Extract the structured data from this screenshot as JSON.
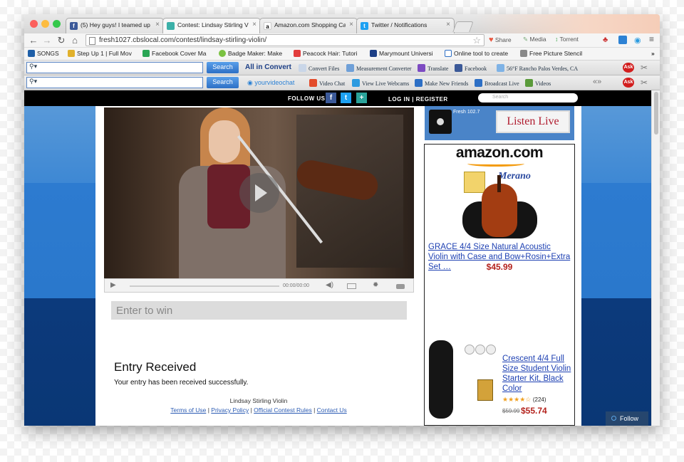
{
  "tabs": [
    {
      "label": "(5) Hey guys! I teamed up",
      "icon": "facebook-icon",
      "color": "#3b5998",
      "glyph": "f"
    },
    {
      "label": "Contest: Lindsay Stirling V",
      "icon": "contest-page-icon",
      "color": "#3bb0a8",
      "glyph": ""
    },
    {
      "label": "Amazon.com Shopping Ca",
      "icon": "amazon-icon",
      "color": "#111111",
      "glyph": "a"
    },
    {
      "label": "Twitter / Notifications",
      "icon": "twitter-icon",
      "color": "#1da1f2",
      "glyph": "t"
    }
  ],
  "nav": {
    "url": "fresh1027.cbslocal.com/contest/lindsay-stirling-violin/",
    "share": "Share",
    "media": "Media",
    "torrent": "Torrent"
  },
  "bookmarks": [
    "SONGS",
    "Step Up 1 | Full Mov",
    "Facebook Cover Ma",
    "Badge Maker: Make",
    "Peacock Hair: Tutori",
    "Marymount Universi",
    "Online tool to create",
    "Free Picture Stencil"
  ],
  "toolbar1": {
    "search_btn": "Search",
    "items": [
      "All in Convert",
      "Convert Files",
      "Measurement Converter",
      "Translate",
      "Facebook",
      "56°F Rancho Palos Verdes, CA"
    ]
  },
  "toolbar2": {
    "search_btn": "Search",
    "items": [
      "yourvideochat",
      "Video Chat",
      "View Live Webcams",
      "Make New Friends",
      "Broadcast Live",
      "Videos"
    ]
  },
  "site": {
    "follow_us": "FOLLOW US",
    "login": "LOG IN",
    "register": "REGISTER",
    "search_placeholder": "Search",
    "video_time": "00:00/00:00",
    "enter_to_win": "Enter to win",
    "entry_title": "Entry Received",
    "entry_text": "Your entry has been received successfully.",
    "footer_title": "Lindsay Stirling Violin",
    "footer_links": [
      "Terms of Use",
      "Privacy Policy",
      "Official Contest Rules",
      "Contact Us"
    ],
    "radio_name": "Fresh 102.7",
    "listen_live": "Listen Live",
    "follow_button": "Follow"
  },
  "ad": {
    "brand": "amazon.com",
    "merano": "Merano",
    "item1_title": "GRACE 4/4 Size Natural Acoustic Violin with Case and Bow+Rosin+Extra Set  …",
    "item1_price": "$45.99",
    "item2_title": "Crescent 4/4 Full Size Student Violin Starter Kit, Black Color",
    "item2_reviews": "(224)",
    "item2_rating": 3.5,
    "item2_old_price": "$59.99",
    "item2_price": "$55.74"
  }
}
